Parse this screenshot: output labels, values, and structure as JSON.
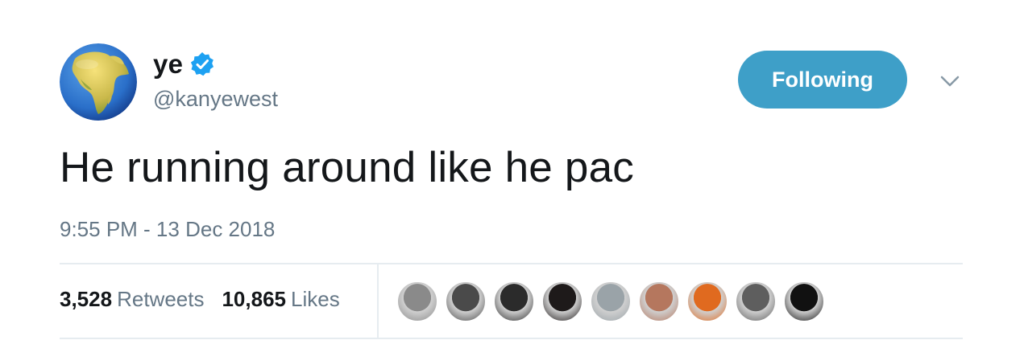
{
  "user": {
    "display_name": "ye",
    "handle": "@kanyewest",
    "verified": true,
    "avatar_icon": "earth-africa-globe-icon"
  },
  "follow_button": {
    "label": "Following",
    "color": "#3e9fc8"
  },
  "tweet": {
    "text": "He running around like he pac",
    "timestamp": "9:55 PM - 13 Dec 2018"
  },
  "stats": {
    "retweets_count": "3,528",
    "retweets_label": "Retweets",
    "likes_count": "10,865",
    "likes_label": "Likes"
  },
  "likers": [
    {
      "name": "liker-avatar-1",
      "color": "#8a8a8a"
    },
    {
      "name": "liker-avatar-2",
      "color": "#4a4a4a"
    },
    {
      "name": "liker-avatar-3",
      "color": "#2b2b2b"
    },
    {
      "name": "liker-avatar-4",
      "color": "#1e1a1a"
    },
    {
      "name": "liker-avatar-5",
      "color": "#9aa3a8"
    },
    {
      "name": "liker-avatar-6",
      "color": "#b5775e"
    },
    {
      "name": "liker-avatar-7",
      "color": "#e06a1f"
    },
    {
      "name": "liker-avatar-8",
      "color": "#5e5e5e"
    },
    {
      "name": "liker-avatar-9",
      "color": "#111111"
    }
  ],
  "colors": {
    "text_primary": "#14171a",
    "text_secondary": "#657786",
    "verified_blue": "#1da1f2",
    "divider": "#e6ecf0"
  }
}
